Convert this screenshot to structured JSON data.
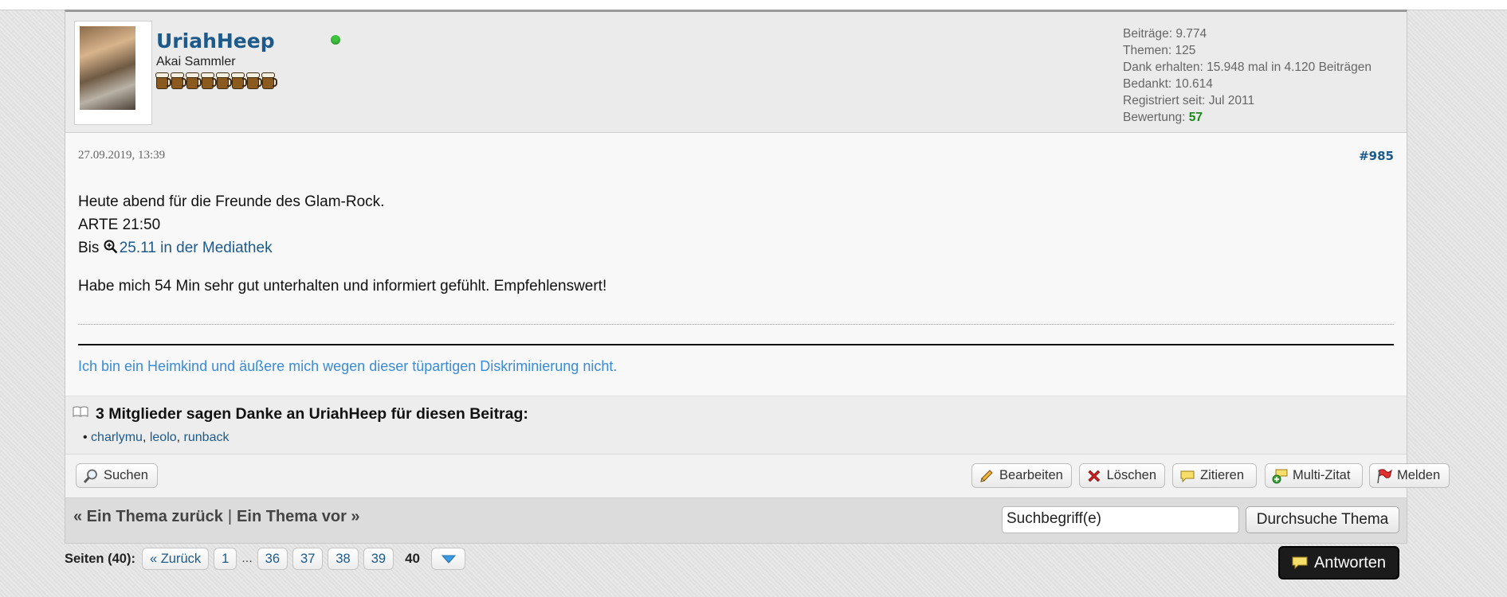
{
  "user": {
    "name": "UriahHeep",
    "title": "Akai Sammler",
    "beer_count": 8,
    "online": true
  },
  "stats": {
    "posts_label": "Beiträge:",
    "posts": "9.774",
    "topics_label": "Themen:",
    "topics": "125",
    "thanks_received_label": "Dank erhalten:",
    "thanks_received": "15.948 mal in 4.120 Beiträgen",
    "thanked_label": "Bedankt:",
    "thanked": "10.614",
    "registered_label": "Registriert seit:",
    "registered": "Jul 2011",
    "rating_label": "Bewertung:",
    "rating": "57"
  },
  "post": {
    "date": "27.09.2019, 13:39",
    "number": "#985",
    "line1": "Heute abend für die Freunde des Glam-Rock.",
    "line2": "ARTE 21:50",
    "line3_prefix": "Bis",
    "line3_link": "25.11 in der Mediathek",
    "line4": "Habe mich 54 Min sehr gut unterhalten und informiert gefühlt. Empfehlenswert!",
    "signature": "Ich bin ein Heimkind und äußere mich wegen dieser tüpartigen Diskriminierung nicht."
  },
  "thanks": {
    "title": "3 Mitglieder sagen Danke an UriahHeep für diesen Beitrag:",
    "members": [
      "charlymu",
      "leolo",
      "runback"
    ]
  },
  "actions": {
    "search": "Suchen",
    "edit": "Bearbeiten",
    "delete": "Löschen",
    "quote": "Zitieren",
    "multiquote": "Multi-Zitat",
    "report": "Melden"
  },
  "thread_nav": {
    "prev": "« Ein Thema zurück",
    "separator": "|",
    "next": "Ein Thema vor »",
    "search_value": "Suchbegriff(e)",
    "search_button": "Durchsuche Thema"
  },
  "pagination": {
    "label": "Seiten (40):",
    "back": "« Zurück",
    "first": "1",
    "ellipsis": "...",
    "pages": [
      "36",
      "37",
      "38",
      "39"
    ],
    "current": "40"
  },
  "reply_button": "Antworten",
  "colors": {
    "link": "#1c5a8c",
    "signature": "#3a8bd8",
    "rating": "#178a17",
    "online": "#3ec53e"
  }
}
